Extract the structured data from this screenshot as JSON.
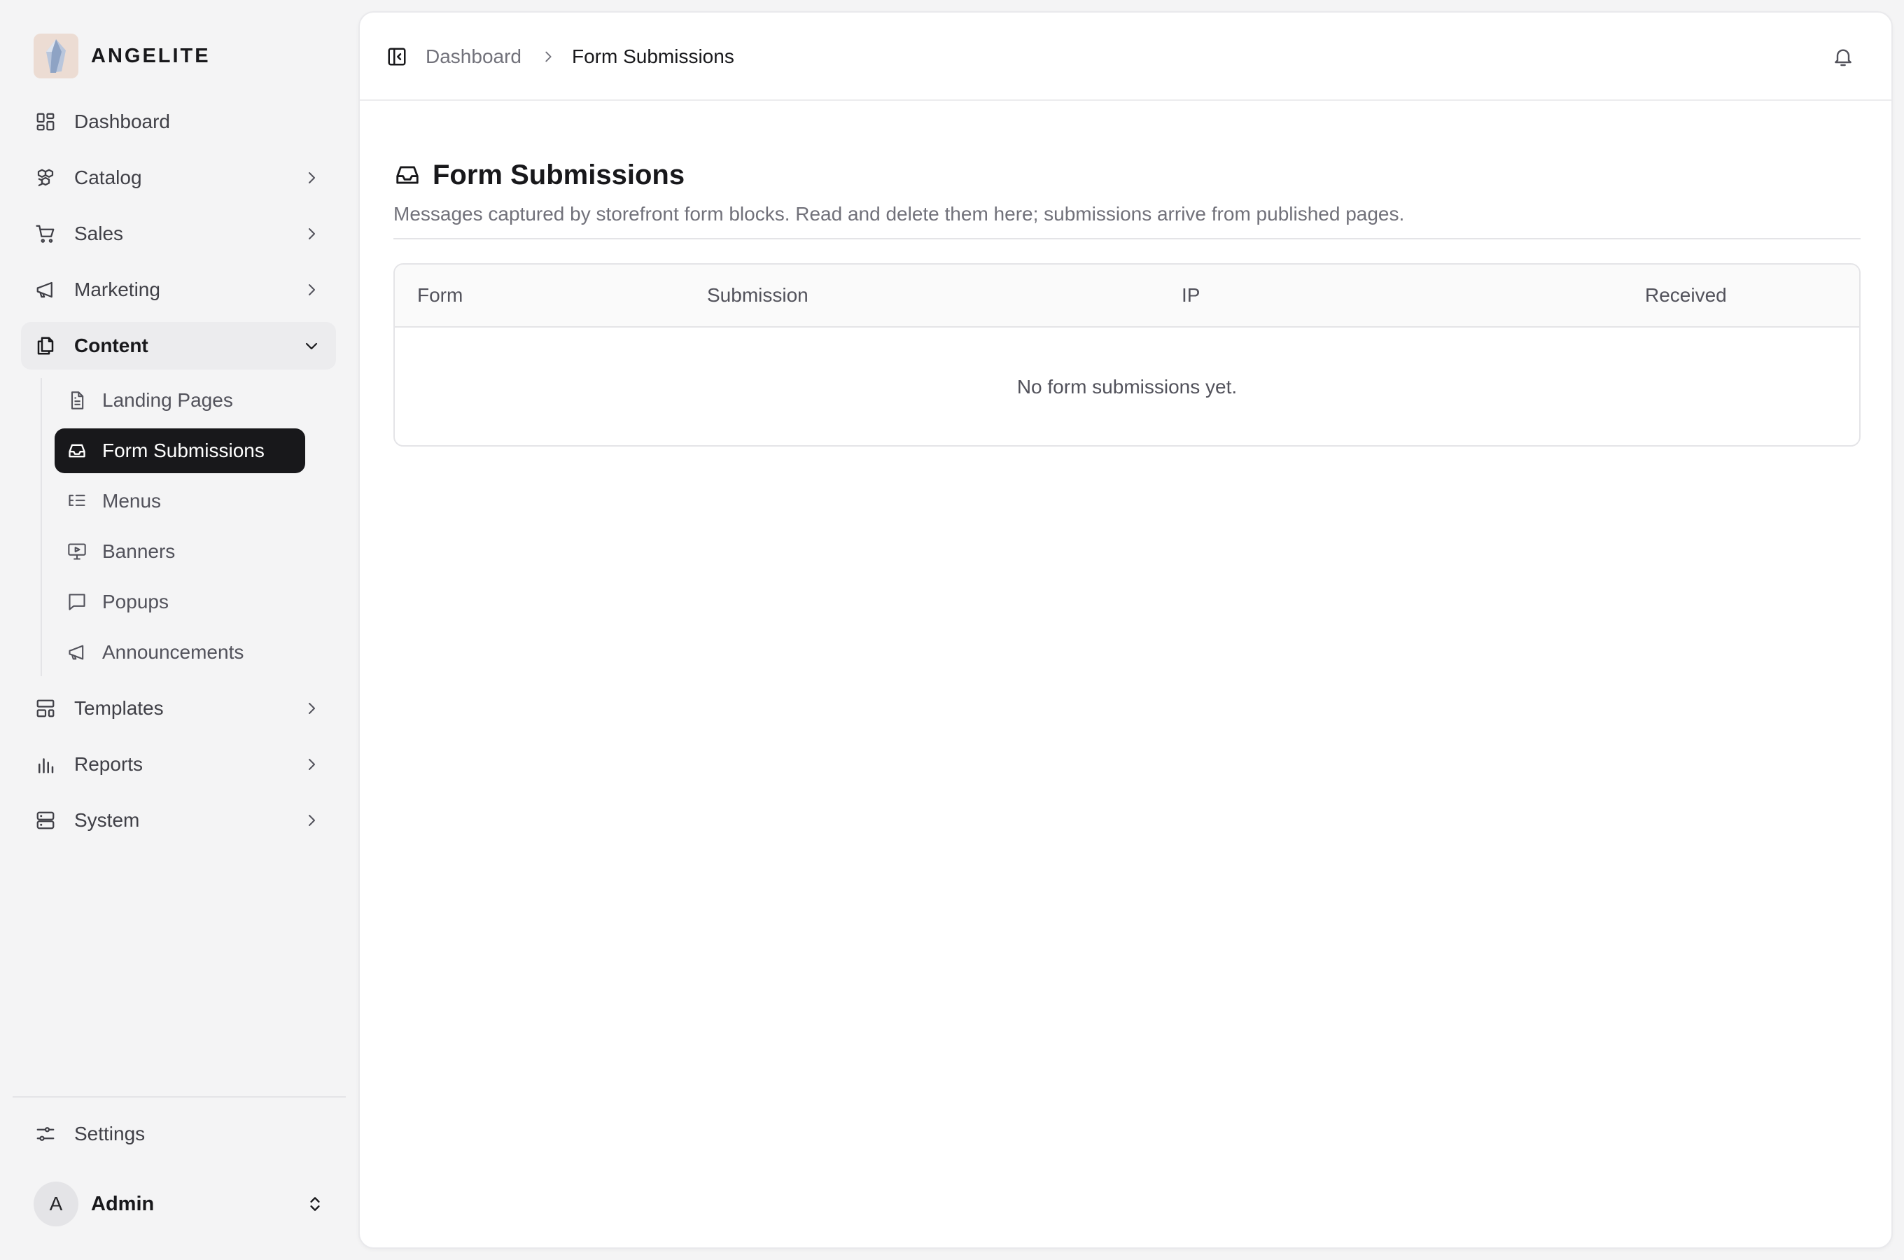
{
  "brand": {
    "name": "ANGELITE"
  },
  "sidebar": {
    "items": [
      {
        "label": "Dashboard"
      },
      {
        "label": "Catalog"
      },
      {
        "label": "Sales"
      },
      {
        "label": "Marketing"
      },
      {
        "label": "Content"
      },
      {
        "label": "Templates"
      },
      {
        "label": "Reports"
      },
      {
        "label": "System"
      }
    ],
    "content_children": [
      {
        "label": "Landing Pages"
      },
      {
        "label": "Form Submissions"
      },
      {
        "label": "Menus"
      },
      {
        "label": "Banners"
      },
      {
        "label": "Popups"
      },
      {
        "label": "Announcements"
      }
    ],
    "settings_label": "Settings",
    "user": {
      "initial": "A",
      "name": "Admin"
    }
  },
  "topbar": {
    "breadcrumb": {
      "parent": "Dashboard",
      "current": "Form Submissions"
    }
  },
  "page": {
    "title": "Form Submissions",
    "description": "Messages captured by storefront form blocks. Read and delete them here; submissions arrive from published pages."
  },
  "table": {
    "columns": [
      "Form",
      "Submission",
      "IP",
      "Received"
    ],
    "empty_message": "No form submissions yet."
  },
  "icons": {
    "dashboard": "layout-grid-icon",
    "catalog": "boxes-icon",
    "sales": "cart-icon",
    "marketing": "megaphone-icon",
    "content": "files-icon",
    "templates": "layout-template-icon",
    "reports": "bar-chart-icon",
    "system": "server-icon",
    "settings": "sliders-icon",
    "notifications": "bell-icon"
  },
  "colors": {
    "active_bg": "#18181b",
    "active_text": "#ffffff",
    "page_bg": "#f4f4f5",
    "muted_text": "#71717a"
  }
}
